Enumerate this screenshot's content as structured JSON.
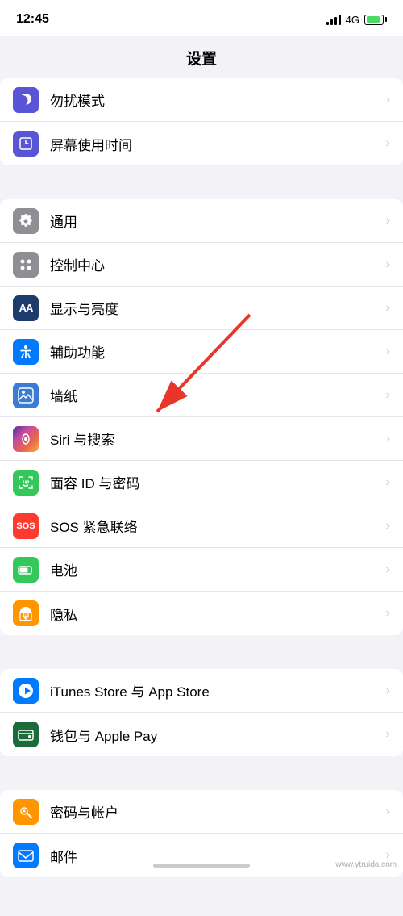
{
  "statusBar": {
    "time": "12:45",
    "network": "4G"
  },
  "pageTitle": "设置",
  "groups": [
    {
      "id": "group1",
      "items": [
        {
          "id": "dnd",
          "label": "勿扰模式",
          "iconBg": "icon-dnd",
          "iconSymbol": "🌙",
          "iconType": "moon"
        },
        {
          "id": "screen-time",
          "label": "屏幕使用时间",
          "iconBg": "icon-screen-time",
          "iconSymbol": "⏱",
          "iconType": "hourglass"
        }
      ]
    },
    {
      "id": "group2",
      "items": [
        {
          "id": "general",
          "label": "通用",
          "iconBg": "icon-gray",
          "iconSymbol": "⚙️",
          "iconType": "gear"
        },
        {
          "id": "control-center",
          "label": "控制中心",
          "iconBg": "icon-gray",
          "iconSymbol": "🎛",
          "iconType": "sliders"
        },
        {
          "id": "display",
          "label": "显示与亮度",
          "iconBg": "icon-blue-dark",
          "iconSymbol": "AA",
          "iconType": "text"
        },
        {
          "id": "accessibility",
          "label": "辅助功能",
          "iconBg": "icon-blue",
          "iconSymbol": "♿",
          "iconType": "person"
        },
        {
          "id": "wallpaper",
          "label": "墙纸",
          "iconBg": "icon-blue",
          "iconSymbol": "🌸",
          "iconType": "flower"
        },
        {
          "id": "siri",
          "label": "Siri 与搜索",
          "iconBg": "icon-siri",
          "iconSymbol": "◉",
          "iconType": "siri"
        },
        {
          "id": "faceid",
          "label": "面容 ID 与密码",
          "iconBg": "icon-green",
          "iconSymbol": "😊",
          "iconType": "face"
        },
        {
          "id": "sos",
          "label": "SOS 紧急联络",
          "iconBg": "icon-red",
          "iconSymbol": "SOS",
          "iconType": "sos"
        },
        {
          "id": "battery",
          "label": "电池",
          "iconBg": "icon-battery-green",
          "iconSymbol": "🔋",
          "iconType": "battery"
        },
        {
          "id": "privacy",
          "label": "隐私",
          "iconBg": "icon-hand",
          "iconSymbol": "✋",
          "iconType": "hand"
        }
      ]
    },
    {
      "id": "group3",
      "items": [
        {
          "id": "itunes",
          "label": "iTunes Store 与 App Store",
          "iconBg": "icon-appstore",
          "iconSymbol": "A",
          "iconType": "appstore"
        },
        {
          "id": "wallet",
          "label": "钱包与 Apple Pay",
          "iconBg": "icon-wallet",
          "iconSymbol": "💳",
          "iconType": "wallet"
        }
      ]
    },
    {
      "id": "group4",
      "items": [
        {
          "id": "passwords",
          "label": "密码与帐户",
          "iconBg": "icon-key",
          "iconSymbol": "🔑",
          "iconType": "key"
        },
        {
          "id": "mail",
          "label": "邮件",
          "iconBg": "icon-mail",
          "iconSymbol": "✉",
          "iconType": "mail"
        }
      ]
    }
  ],
  "watermark": "www.ytruida.com"
}
